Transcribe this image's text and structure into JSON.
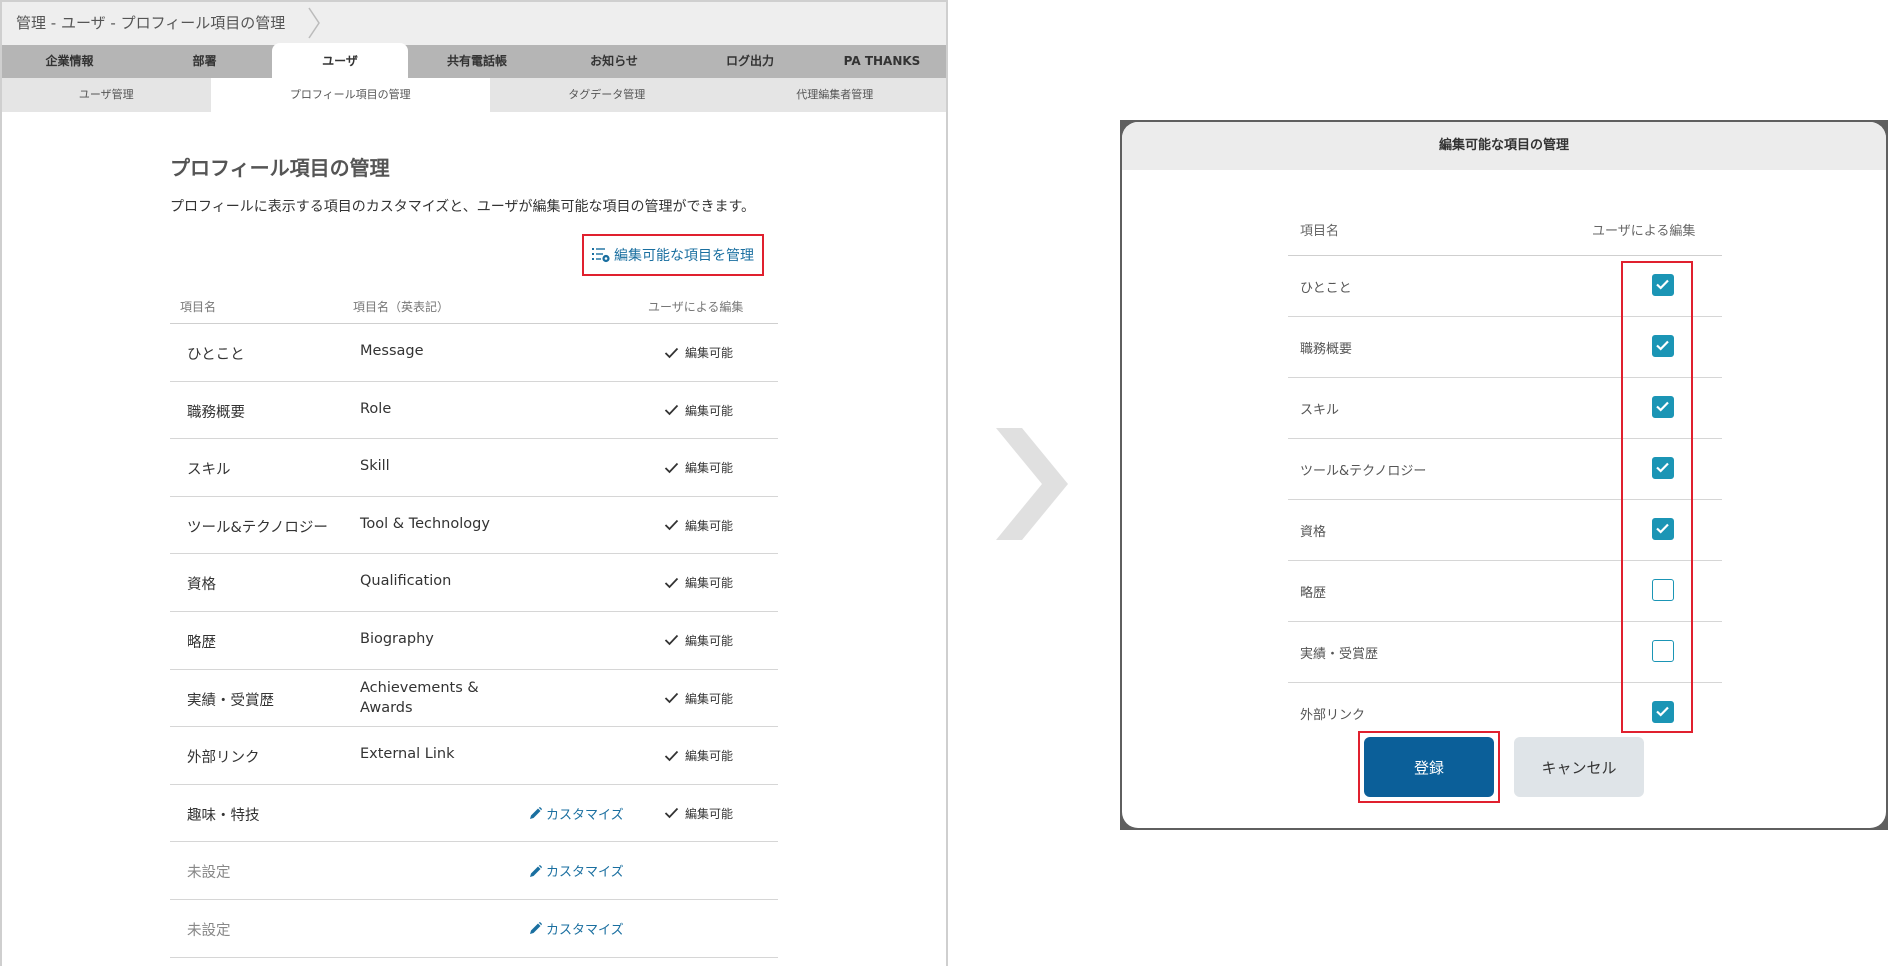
{
  "left": {
    "breadcrumb": "管理 - ユーザ - プロフィール項目の管理",
    "main_tabs": [
      {
        "label": "企業情報",
        "active": false
      },
      {
        "label": "部署",
        "active": false
      },
      {
        "label": "ユーザ",
        "active": true
      },
      {
        "label": "共有電話帳",
        "active": false
      },
      {
        "label": "お知らせ",
        "active": false
      },
      {
        "label": "ログ出力",
        "active": false
      },
      {
        "label": "PA THANKS",
        "active": false
      }
    ],
    "sub_tabs": [
      {
        "label": "ユーザ管理",
        "active": false
      },
      {
        "label": "プロフィール項目の管理",
        "active": true
      },
      {
        "label": "タグデータ管理",
        "active": false
      },
      {
        "label": "代理編集者管理",
        "active": false
      }
    ],
    "title": "プロフィール項目の管理",
    "description": "プロフィールに表示する項目のカスタマイズと、ユーザが編集可能な項目の管理ができます。",
    "manage_link": "編集可能な項目を管理",
    "table": {
      "headers": [
        "項目名",
        "項目名（英表記）",
        "ユーザによる編集"
      ],
      "rows": [
        {
          "name": "ひとこと",
          "en": "Message",
          "customize": "",
          "editable": "編集可能"
        },
        {
          "name": "職務概要",
          "en": "Role",
          "customize": "",
          "editable": "編集可能"
        },
        {
          "name": "スキル",
          "en": "Skill",
          "customize": "",
          "editable": "編集可能"
        },
        {
          "name": "ツール&テクノロジー",
          "en": "Tool & Technology",
          "customize": "",
          "editable": "編集可能"
        },
        {
          "name": "資格",
          "en": "Qualification",
          "customize": "",
          "editable": "編集可能"
        },
        {
          "name": "略歴",
          "en": "Biography",
          "customize": "",
          "editable": "編集可能"
        },
        {
          "name": "実績・受賞歴",
          "en": "Achievements & Awards",
          "customize": "",
          "editable": "編集可能"
        },
        {
          "name": "外部リンク",
          "en": "External Link",
          "customize": "",
          "editable": "編集可能"
        },
        {
          "name": "趣味・特技",
          "en": "",
          "customize": "カスタマイズ",
          "editable": "編集可能"
        },
        {
          "name": "未設定",
          "en": "",
          "customize": "カスタマイズ",
          "editable": ""
        },
        {
          "name": "未設定",
          "en": "",
          "customize": "カスタマイズ",
          "editable": ""
        }
      ]
    }
  },
  "modal": {
    "title": "編集可能な項目の管理",
    "headers": [
      "項目名",
      "ユーザによる編集"
    ],
    "rows": [
      {
        "name": "ひとこと",
        "checked": true
      },
      {
        "name": "職務概要",
        "checked": true
      },
      {
        "name": "スキル",
        "checked": true
      },
      {
        "name": "ツール&テクノロジー",
        "checked": true
      },
      {
        "name": "資格",
        "checked": true
      },
      {
        "name": "略歴",
        "checked": false
      },
      {
        "name": "実績・受賞歴",
        "checked": false
      },
      {
        "name": "外部リンク",
        "checked": true
      }
    ],
    "register_label": "登録",
    "cancel_label": "キャンセル"
  },
  "colors": {
    "accent": "#1b95b5",
    "primary_button": "#0b5f99",
    "link": "#1a6fa0",
    "highlight": "#e0202e"
  },
  "icons": {
    "manage_link_icon": "list-settings-icon",
    "customize_icon": "pencil-icon",
    "editable_icon": "checkmark-icon",
    "checkbox_icon": "checkbox-check-icon",
    "transition_icon": "chevron-right-icon"
  }
}
